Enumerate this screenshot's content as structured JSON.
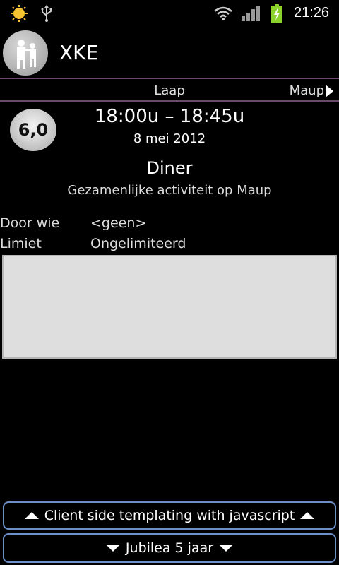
{
  "status_bar": {
    "time": "21:26",
    "icons": [
      "sun-icon",
      "usb-icon",
      "wifi-icon",
      "signal-icon",
      "battery-charging-icon"
    ]
  },
  "header": {
    "title": "XKE",
    "icon": "app-logo-icon"
  },
  "nav": {
    "current": "Laap",
    "next": "Maup"
  },
  "event": {
    "badge": "6,0",
    "time_range": "18:00u – 18:45u",
    "date": "8 mei 2012",
    "title": "Diner",
    "subtitle": "Gezamenlijke activiteit op Maup",
    "details": [
      {
        "label": "Door wie",
        "value": "<geen>"
      },
      {
        "label": "Limiet",
        "value": "Ongelimiteerd"
      }
    ]
  },
  "buttons": {
    "up_label": "Client side templating with javascript",
    "down_label": "Jubilea 5 jaar"
  },
  "colors": {
    "background": "#000000",
    "nav_border": "#6a4a6a",
    "button_border": "#6c8fc8",
    "content_box": "#dedede"
  }
}
